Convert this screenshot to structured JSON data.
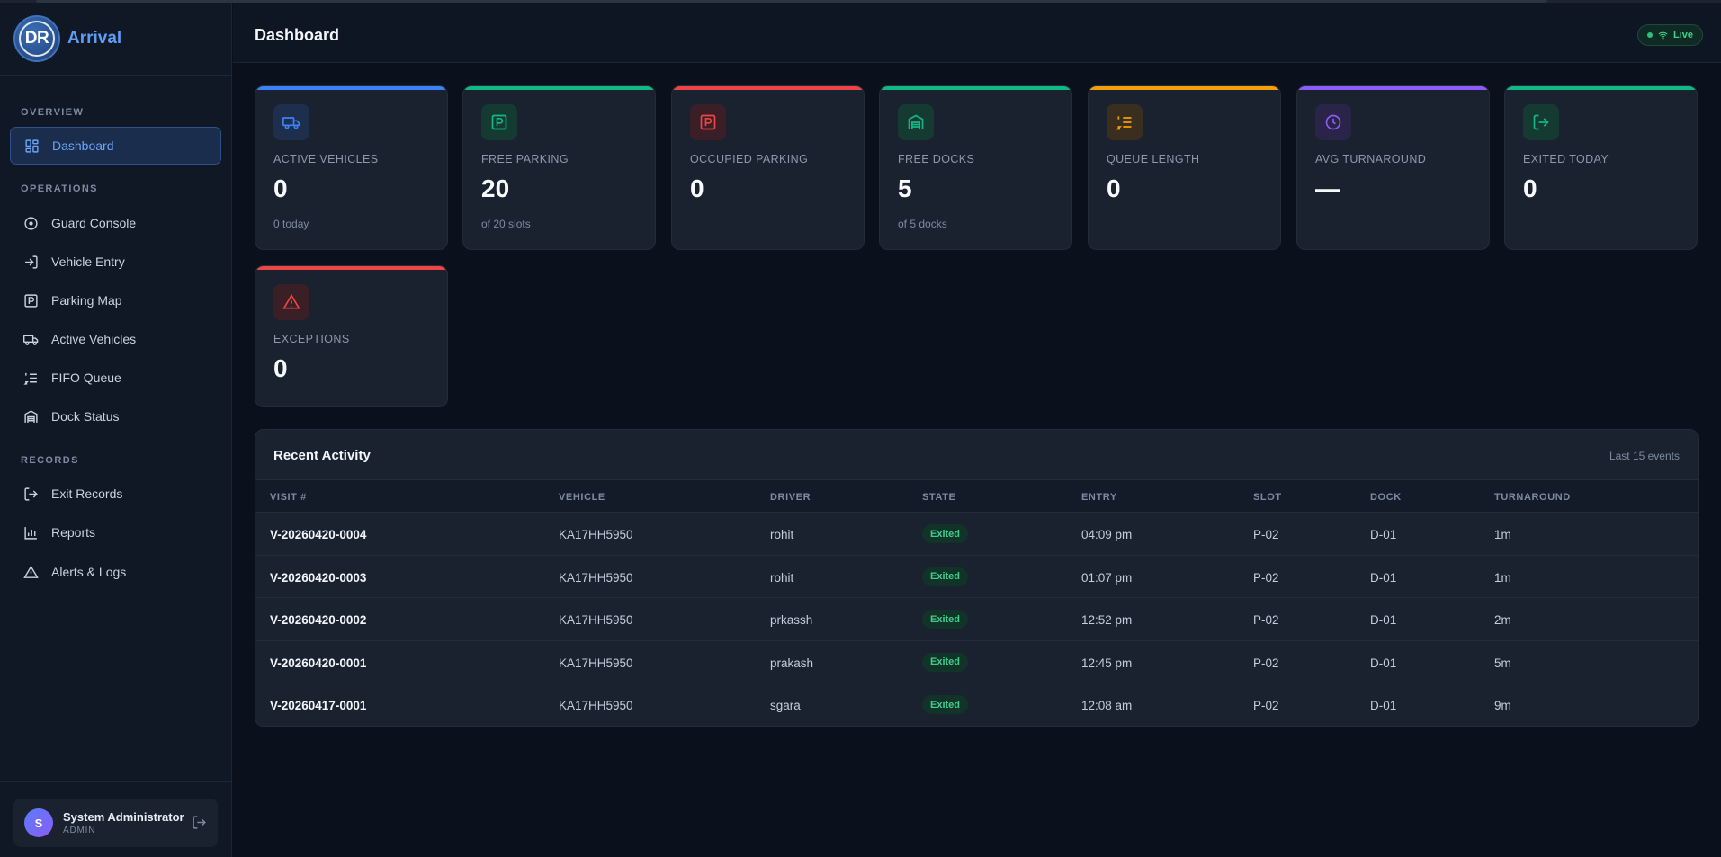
{
  "brand": {
    "logo_text": "DR",
    "name": "Arrival"
  },
  "sidebar": {
    "sections": [
      {
        "label": "OVERVIEW",
        "items": [
          {
            "label": "Dashboard",
            "icon": "grid-icon",
            "active": true
          }
        ]
      },
      {
        "label": "OPERATIONS",
        "items": [
          {
            "label": "Guard Console",
            "icon": "target-icon"
          },
          {
            "label": "Vehicle Entry",
            "icon": "login-icon"
          },
          {
            "label": "Parking Map",
            "icon": "parking-icon"
          },
          {
            "label": "Active Vehicles",
            "icon": "truck-icon"
          },
          {
            "label": "FIFO Queue",
            "icon": "list-icon"
          },
          {
            "label": "Dock Status",
            "icon": "warehouse-icon"
          }
        ]
      },
      {
        "label": "RECORDS",
        "items": [
          {
            "label": "Exit Records",
            "icon": "logout-icon"
          },
          {
            "label": "Reports",
            "icon": "bar-chart-icon"
          },
          {
            "label": "Alerts & Logs",
            "icon": "alert-icon"
          }
        ]
      }
    ]
  },
  "user": {
    "initial": "S",
    "name": "System Administrator",
    "role": "ADMIN"
  },
  "header": {
    "title": "Dashboard",
    "live_label": "Live"
  },
  "stats": [
    {
      "label": "ACTIVE VEHICLES",
      "value": "0",
      "sub": "0 today",
      "color": "#3b82f6",
      "icon": "truck-icon"
    },
    {
      "label": "FREE PARKING",
      "value": "20",
      "sub": "of 20 slots",
      "color": "#10b981",
      "icon": "parking-icon"
    },
    {
      "label": "OCCUPIED PARKING",
      "value": "0",
      "sub": "",
      "color": "#ef4444",
      "icon": "parking-icon"
    },
    {
      "label": "FREE DOCKS",
      "value": "5",
      "sub": "of 5 docks",
      "color": "#10b981",
      "icon": "warehouse-icon"
    },
    {
      "label": "QUEUE LENGTH",
      "value": "0",
      "sub": "",
      "color": "#f59e0b",
      "icon": "list-icon"
    },
    {
      "label": "AVG TURNAROUND",
      "value": "—",
      "sub": "",
      "color": "#8b5cf6",
      "icon": "clock-icon"
    },
    {
      "label": "EXITED TODAY",
      "value": "0",
      "sub": "",
      "color": "#10b981",
      "icon": "logout-icon"
    },
    {
      "label": "EXCEPTIONS",
      "value": "0",
      "sub": "",
      "color": "#ef4444",
      "icon": "alert-icon"
    }
  ],
  "activity": {
    "title": "Recent Activity",
    "meta": "Last 15 events",
    "columns": [
      "VISIT #",
      "VEHICLE",
      "DRIVER",
      "STATE",
      "ENTRY",
      "SLOT",
      "DOCK",
      "TURNAROUND"
    ],
    "rows": [
      {
        "visit": "V-20260420-0004",
        "vehicle": "KA17HH5950",
        "driver": "rohit",
        "state": "Exited",
        "entry": "04:09 pm",
        "slot": "P-02",
        "dock": "D-01",
        "turnaround": "1m"
      },
      {
        "visit": "V-20260420-0003",
        "vehicle": "KA17HH5950",
        "driver": "rohit",
        "state": "Exited",
        "entry": "01:07 pm",
        "slot": "P-02",
        "dock": "D-01",
        "turnaround": "1m"
      },
      {
        "visit": "V-20260420-0002",
        "vehicle": "KA17HH5950",
        "driver": "prkassh",
        "state": "Exited",
        "entry": "12:52 pm",
        "slot": "P-02",
        "dock": "D-01",
        "turnaround": "2m"
      },
      {
        "visit": "V-20260420-0001",
        "vehicle": "KA17HH5950",
        "driver": "prakash",
        "state": "Exited",
        "entry": "12:45 pm",
        "slot": "P-02",
        "dock": "D-01",
        "turnaround": "5m"
      },
      {
        "visit": "V-20260417-0001",
        "vehicle": "KA17HH5950",
        "driver": "sgara",
        "state": "Exited",
        "entry": "12:08 am",
        "slot": "P-02",
        "dock": "D-01",
        "turnaround": "9m"
      }
    ]
  }
}
